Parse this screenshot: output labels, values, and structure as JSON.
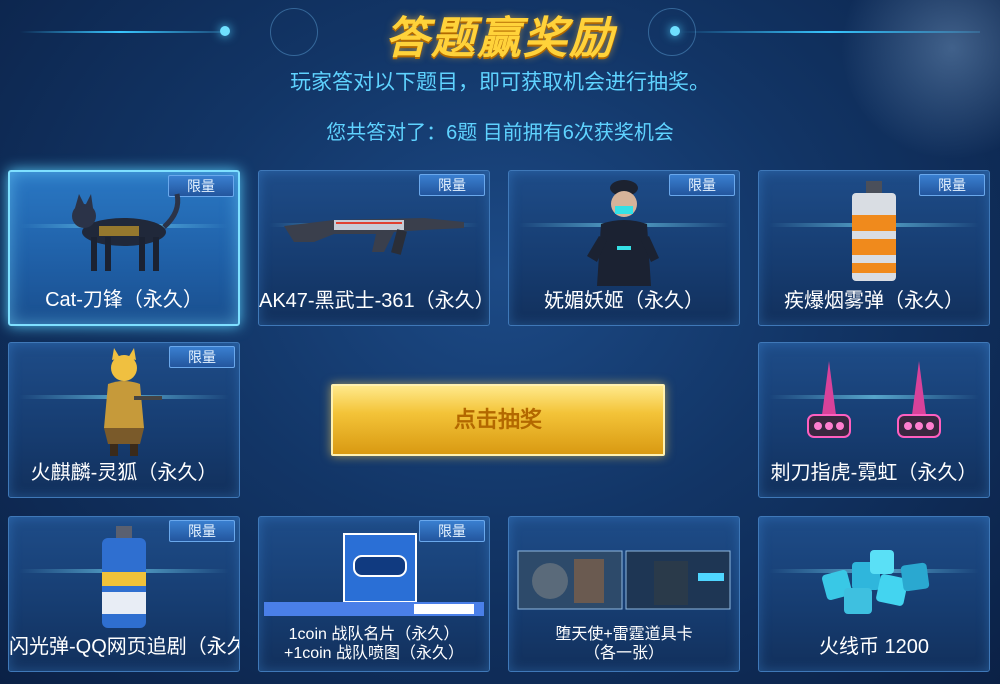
{
  "header": {
    "title": "答题赢奖励",
    "subtitle": "玩家答对以下题目，即可获取机会进行抽奖。",
    "status": "您共答对了：6题 目前拥有6次获奖机会"
  },
  "action": {
    "draw_label": "点击抽奖"
  },
  "prizes": [
    {
      "label": "Cat-刀锋（永久）",
      "badge": "限量",
      "icon": "cat-character-icon",
      "selected": true
    },
    {
      "label": "AK47-黑武士-361（永久）",
      "badge": "限量",
      "icon": "rifle-icon"
    },
    {
      "label": "妩媚妖姬（永久）",
      "badge": "限量",
      "icon": "female-character-icon"
    },
    {
      "label": "疾爆烟雾弹（永久）",
      "badge": "限量",
      "icon": "smoke-grenade-icon"
    },
    {
      "label": "火麒麟-灵狐（永久）",
      "badge": "限量",
      "icon": "fox-character-icon"
    },
    {
      "label": "刺刀指虎-霓虹（永久）",
      "badge": "",
      "icon": "knuckle-knife-icon"
    },
    {
      "label": "闪光弹-QQ网页追剧（永久）",
      "badge": "限量",
      "icon": "flashbang-icon"
    },
    {
      "label_line1": "1coin 战队名片（永久）",
      "label_line2": "+1coin 战队喷图（永久）",
      "badge": "限量",
      "icon": "team-card-icon"
    },
    {
      "label_line1": "堕天使+雷霆道具卡",
      "label_line2": "（各一张）",
      "badge": "",
      "icon": "item-card-icon"
    },
    {
      "label": "火线币 1200",
      "badge": "",
      "icon": "coin-stack-icon"
    }
  ],
  "colors": {
    "accent": "#5fd3ff",
    "title": "#ffd23a",
    "button": "#f3c338",
    "card_bg": "#1e4c88"
  }
}
